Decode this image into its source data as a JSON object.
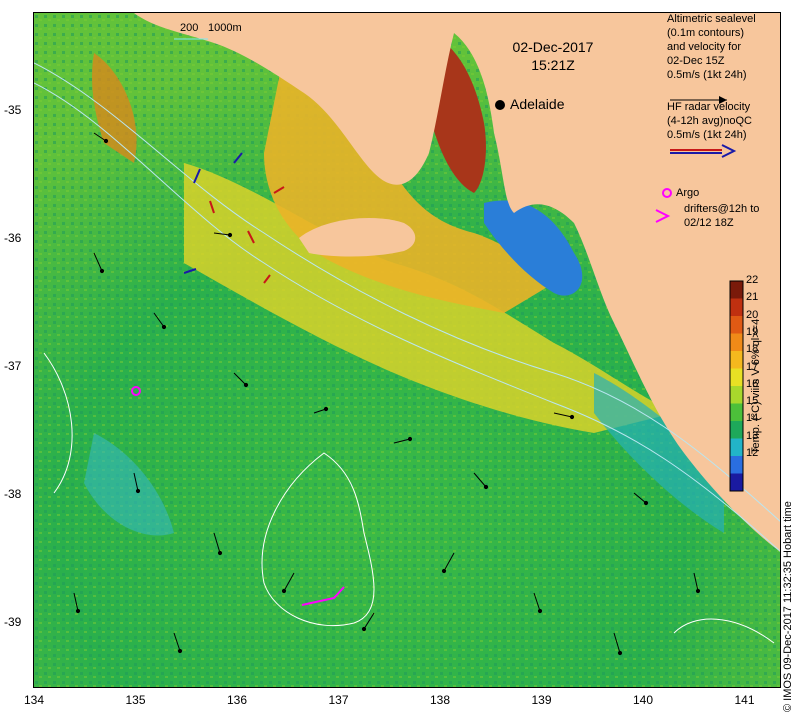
{
  "map": {
    "lon_ticks": [
      "134",
      "135",
      "136",
      "137",
      "138",
      "139",
      "140",
      "141"
    ],
    "lat_ticks": [
      "-35",
      "-36",
      "-37",
      "-38",
      "-39"
    ],
    "date": "02-Dec-2017",
    "time": "15:21Z",
    "city": "Adelaide",
    "bathy_scale": {
      "a": "200",
      "b": "1000m"
    },
    "credit": "© IMOS 09-Dec-2017 11:32:35 Hobart time"
  },
  "legend": {
    "altimetry": [
      "Altimetric sealevel",
      "(0.1m contours)",
      "and velocity for",
      "02-Dec 15Z",
      "0.5m/s (1kt 24h)"
    ],
    "hf_radar": [
      "HF radar velocity",
      "(4-12h avg)noQC",
      "0.5m/s (1kt 24h)"
    ],
    "argo": "Argo",
    "drifters": [
      "drifters@12h to",
      "02/12 18Z"
    ]
  },
  "colorbar": {
    "ticks": [
      "22",
      "21",
      "20",
      "19",
      "18",
      "17",
      "16",
      "15",
      "14",
      "13",
      "12"
    ],
    "title": "Temp. (°C) viirs V 6% ql>=4",
    "colors": [
      "#7a1a0a",
      "#c03010",
      "#e05a14",
      "#f08a18",
      "#f4b81e",
      "#e8e024",
      "#a8d82c",
      "#4cc03a",
      "#1ea85a",
      "#22b4c8",
      "#2a6ee0",
      "#1a1aa0"
    ]
  },
  "colors": {
    "land": "#f7c69c",
    "ocean_warm": "#e8b420",
    "ocean_mid": "#4cc03a",
    "ocean_cool": "#22b4c8",
    "argo": "#ff00ff",
    "drifter": "#ff00ff"
  }
}
